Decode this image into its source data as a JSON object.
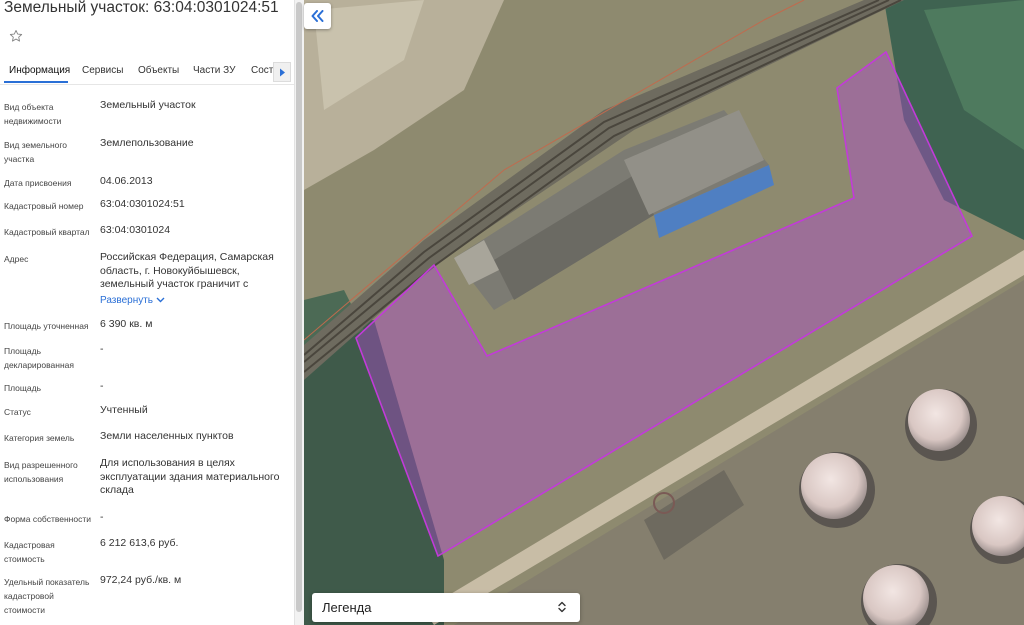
{
  "panel": {
    "title": "Земельный участок: 63:04:0301024:51",
    "tabs": [
      {
        "label": "Информация",
        "active": true
      },
      {
        "label": "Сервисы"
      },
      {
        "label": "Объекты"
      },
      {
        "label": "Части ЗУ"
      },
      {
        "label": "Соста"
      }
    ],
    "rows": [
      {
        "label": "Вид объекта недвижимости",
        "value": "Земельный участок"
      },
      {
        "label": "Вид земельного участка",
        "value": "Землепользование"
      },
      {
        "label": "Дата присвоения",
        "value": "04.06.2013"
      },
      {
        "label": "Кадастровый номер",
        "value": "63:04:0301024:51"
      },
      {
        "label": "Кадастровый квартал",
        "value": "63:04:0301024"
      },
      {
        "label": "Адрес",
        "value": "Российская Федерация, Самарская область, г. Новокуйбышевск, земельный участок граничит с"
      },
      {
        "label": "Площадь уточненная",
        "value": "6 390 кв. м"
      },
      {
        "label": "Площадь декларированная",
        "value": "-"
      },
      {
        "label": "Площадь",
        "value": "-"
      },
      {
        "label": "Статус",
        "value": "Учтенный"
      },
      {
        "label": "Категория земель",
        "value": "Земли населенных пунктов"
      },
      {
        "label": "Вид разрешенного использования",
        "value": "Для использования в целях эксплуатации здания материального склада"
      },
      {
        "label": "Форма собственности",
        "value": "-"
      },
      {
        "label": "Кадастровая стоимость",
        "value": "6 212 613,6 руб."
      },
      {
        "label": "Удельный показатель кадастровой стоимости",
        "value": "972,24 руб./кв. м"
      }
    ],
    "expand_label": "Развернуть"
  },
  "map": {
    "legend_label": "Легенда",
    "parcel_color": "#b04ad0",
    "icons": [
      "double-chevron-left-icon",
      "star-outline-icon",
      "chevron-right-icon",
      "chevron-down-icon",
      "up-down-chevron-icon"
    ]
  }
}
